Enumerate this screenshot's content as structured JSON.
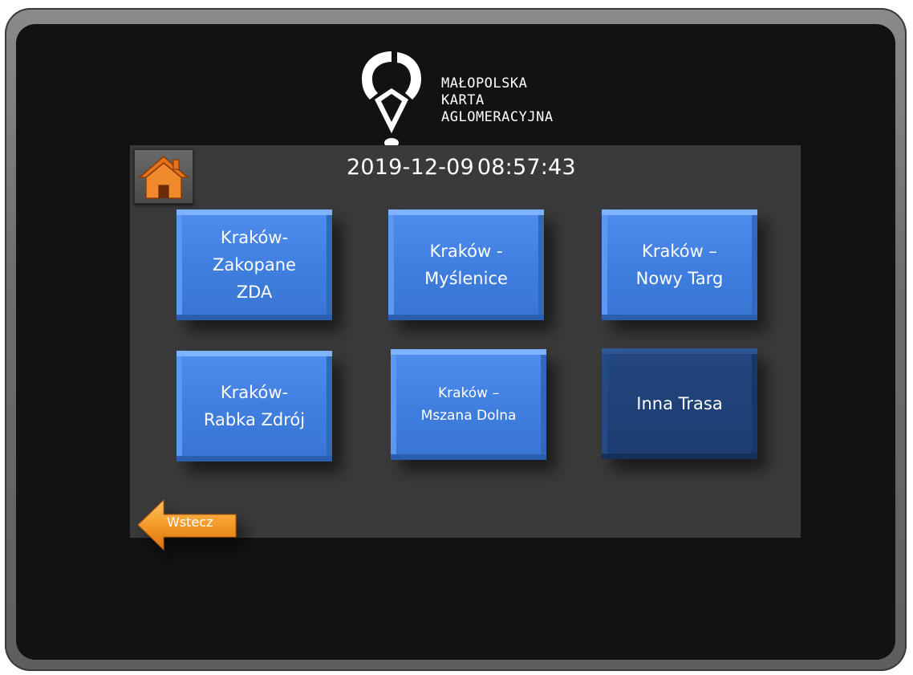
{
  "logo": {
    "line1": "MAŁOPOLSKA",
    "line2": "KARTA",
    "line3": "AGLOMERACYJNA"
  },
  "header": {
    "date": "2019-12-09",
    "time": "08:57:43"
  },
  "routes": [
    {
      "label": "Kraków-\nZakopane\nZDA"
    },
    {
      "label": "Kraków -\nMyślenice"
    },
    {
      "label": "Kraków –\nNowy Targ"
    },
    {
      "label": "Kraków-\nRabka Zdrój"
    },
    {
      "label": "Kraków –\nMszana Dolna"
    },
    {
      "label": "Inna Trasa"
    }
  ],
  "nav": {
    "back_label": "Wstecz",
    "home_icon": "home-icon",
    "back_icon": "arrow-left-icon"
  },
  "colors": {
    "button_blue": "#3d7de0",
    "button_dark": "#1b3e74",
    "panel": "#3a3a3a",
    "bezel": "#121212",
    "home_orange": "#e5731a",
    "back_orange": "#f39a2a"
  }
}
